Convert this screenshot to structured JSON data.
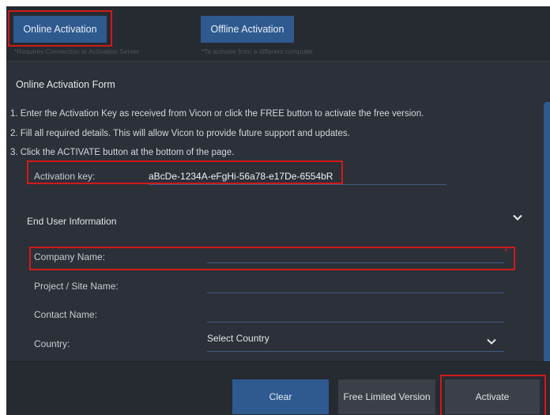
{
  "tabs": {
    "online": {
      "label": "Online Activation",
      "hint": "*Requires Connection to Activation Server"
    },
    "offline": {
      "label": "Offline Activation",
      "hint": "*To activate from a different computer"
    }
  },
  "form": {
    "title": "Online Activation Form",
    "instructions": [
      "1. Enter the Activation Key as received from Vicon or click the FREE button to activate the free version.",
      "2. Fill all required details. This will allow Vicon to provide future support and updates.",
      "3. Click the ACTIVATE button at the bottom of the page."
    ],
    "activation_key": {
      "label": "Activation key:",
      "value": "aBcDe-1234A-eFgHi-56a78-e17De-6554bR"
    },
    "end_user": {
      "title": "End User Information",
      "company_label": "Company Name:",
      "required_mark": "*",
      "project_label": "Project / Site Name:",
      "contact_label": "Contact Name:",
      "country_label": "Country:",
      "country_value": "Select Country"
    }
  },
  "footer": {
    "clear": "Clear",
    "free": "Free Limited Version",
    "activate": "Activate"
  },
  "colors": {
    "accent": "#2f5a90",
    "highlight": "#d01a1a",
    "background": "#262a31"
  }
}
